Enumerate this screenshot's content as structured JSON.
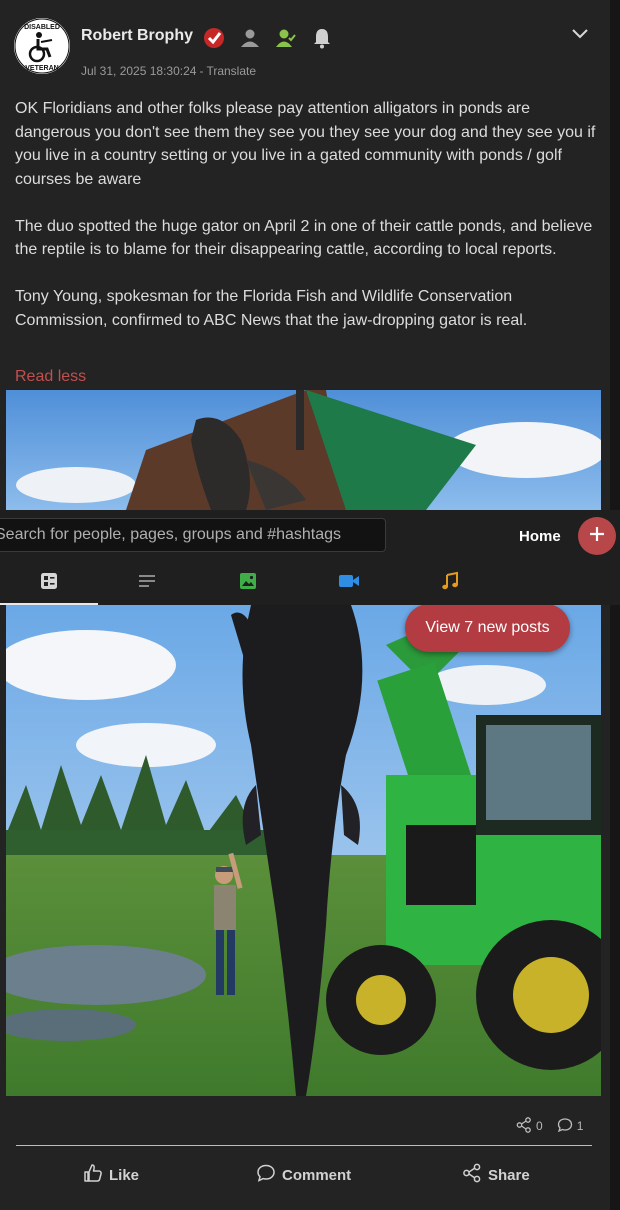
{
  "post": {
    "author": "Robert Brophy",
    "avatar_text_top": "DISABLED",
    "avatar_text_bottom": "VETERAN",
    "timestamp": "Jul 31, 2025 18:30:24",
    "meta_separator": "-",
    "translate_label": "Translate",
    "paragraphs": [
      "OK Floridians and other folks please pay attention alligators in ponds are dangerous you don't see them they see you they see your dog and they see you if you live in a country setting or you live in a gated community with ponds / golf courses be aware",
      "The duo spotted the huge gator on April 2 in one of their cattle ponds, and believe the reptile is to blame for their disappearing cattle, according to local reports.",
      "Tony Young, spokesman for the Florida Fish and Wildlife Conservation Commission, confirmed to ABC News that the jaw-dropping gator is real."
    ],
    "read_less_label": "Read less",
    "share_count": "0",
    "comment_count": "1"
  },
  "topbar": {
    "search_placeholder": "Search for people, pages, groups and #hashtags",
    "home_label": "Home",
    "tabs": [
      {
        "name": "all-posts",
        "icon": "feed-icon",
        "active": true
      },
      {
        "name": "text",
        "icon": "text-lines-icon",
        "active": false
      },
      {
        "name": "photos",
        "icon": "image-icon",
        "active": false
      },
      {
        "name": "videos",
        "icon": "video-camera-icon",
        "active": false
      },
      {
        "name": "music",
        "icon": "music-note-icon",
        "active": false
      }
    ]
  },
  "new_posts_button": "View 7 new posts",
  "actions": {
    "like_label": "Like",
    "comment_label": "Comment",
    "share_label": "Share"
  },
  "colors": {
    "accent": "#b8474a",
    "read_less": "#c0504d",
    "image_tab": "#3fae49",
    "video_tab": "#2f8de4",
    "music_tab": "#e39a1e",
    "background": "#232324"
  }
}
